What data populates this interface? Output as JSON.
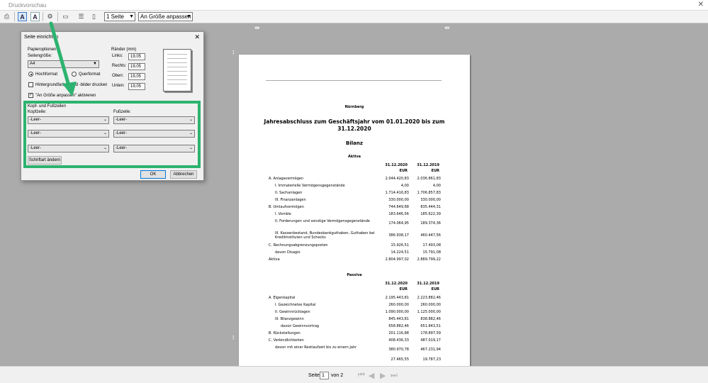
{
  "window": {
    "title": "Druckvorschau",
    "close": "✕"
  },
  "toolbar": {
    "pages_select": "1 Seite",
    "zoom_select": "An Größe anpassen"
  },
  "dialog": {
    "title": "Seite einrichten",
    "close": "✕",
    "paper_options": "Papieroptionen",
    "page_size_label": "Seitengröße:",
    "page_size_value": "A4",
    "portrait": "Hochformat",
    "landscape": "Querformat",
    "bg_print": "Hintergrundfarben und -bilder drucken",
    "fit_to_size": "\"An Größe anpassen\" aktivieren",
    "margins_title": "Ränder (mm)",
    "margin_left_label": "Links:",
    "margin_left": "19,05",
    "margin_right_label": "Rechts:",
    "margin_right": "19,05",
    "margin_top_label": "Oben:",
    "margin_top": "19,05",
    "margin_bottom_label": "Unten:",
    "margin_bottom": "19,05",
    "header_footer_title": "Kopf- und Fußzeilen",
    "header_label": "Kopfzeile:",
    "footer_label": "Fußzeile:",
    "header_1": "-Leer-",
    "header_2": "-Leer-",
    "header_3": "-Leer-",
    "footer_1": "-Leer-",
    "footer_2": "-Leer-",
    "footer_3": "-Leer-",
    "font_button": "Schriftart ändern",
    "ok": "OK",
    "cancel": "Abbrechen"
  },
  "document": {
    "city": "Nürnberg",
    "heading": "Jahresabschluss zum Geschäftsjahr vom 01.01.2020 bis zum 31.12.2020",
    "bilanz": "Bilanz",
    "aktiva_title": "Aktiva",
    "passiva_title": "Passiva",
    "col1": "31.12.2020",
    "col2": "31.12.2019",
    "currency": "EUR",
    "aktiva_rows": [
      {
        "label": "A. Anlagevermögen",
        "v1": "2.044.420,83",
        "v2": "2.036.861,83"
      },
      {
        "label": "I. Immaterielle Vermögensgegenstände",
        "v1": "4,00",
        "v2": "4,00"
      },
      {
        "label": "II. Sachanlagen",
        "v1": "1.714.416,83",
        "v2": "1.706.857,83"
      },
      {
        "label": "III. Finanzanlagen",
        "v1": "330.000,00",
        "v2": "330.000,00"
      },
      {
        "label": "B. Umlaufvermögen",
        "v1": "744.649,68",
        "v2": "835.444,31"
      },
      {
        "label": "I. Vorräte",
        "v1": "183.646,56",
        "v2": "185.622,39"
      },
      {
        "label": "II. Forderungen und sonstige Vermögensgegenstände",
        "v1": "174.064,95",
        "v2": "189.374,36"
      },
      {
        "label": "III. Kassenbestand, Bundesbankguthaben, Guthaben bei Kreditinstituten und Schecks",
        "v1": "386.938,17",
        "v2": "460.447,56"
      },
      {
        "label": "C. Rechnungsabgrenzungsposten",
        "v1": "15.926,51",
        "v2": "17.493,08"
      },
      {
        "label": "davon Disagio",
        "v1": "14.224,51",
        "v2": "15.791,08"
      },
      {
        "label": "Aktiva",
        "v1": "2.804.997,02",
        "v2": "2.889.799,22"
      }
    ],
    "passiva_rows": [
      {
        "label": "A. Eigenkapital",
        "v1": "2.195.443,81",
        "v2": "2.223.882,46"
      },
      {
        "label": "I. Gezeichnetes Kapital",
        "v1": "260.000,00",
        "v2": "260.000,00"
      },
      {
        "label": "II. Gewinnrücklagen",
        "v1": "1.090.000,00",
        "v2": "1.125.000,00"
      },
      {
        "label": "III. Bilanzgewinn",
        "v1": "845.443,81",
        "v2": "838.882,46"
      },
      {
        "label": "davon Gewinnvortrag",
        "v1": "658.882,46",
        "v2": "651.843,51"
      },
      {
        "label": "B. Rückstellungen",
        "v1": "201.116,88",
        "v2": "178.897,59"
      },
      {
        "label": "C. Verbindlichkeiten",
        "v1": "408.436,33",
        "v2": "487.019,17"
      },
      {
        "label": "davon mit einer Restlaufzeit bis zu einem Jahr",
        "v1": "380.970,78",
        "v2": "467.231,94"
      },
      {
        "label": "",
        "v1": "27.465,55",
        "v2": "19.787,23"
      }
    ]
  },
  "status": {
    "page_label": "Seite",
    "page_value": "1",
    "of_label": "von 2"
  },
  "colors": {
    "highlight": "#2db36f",
    "background": "#ababab"
  }
}
